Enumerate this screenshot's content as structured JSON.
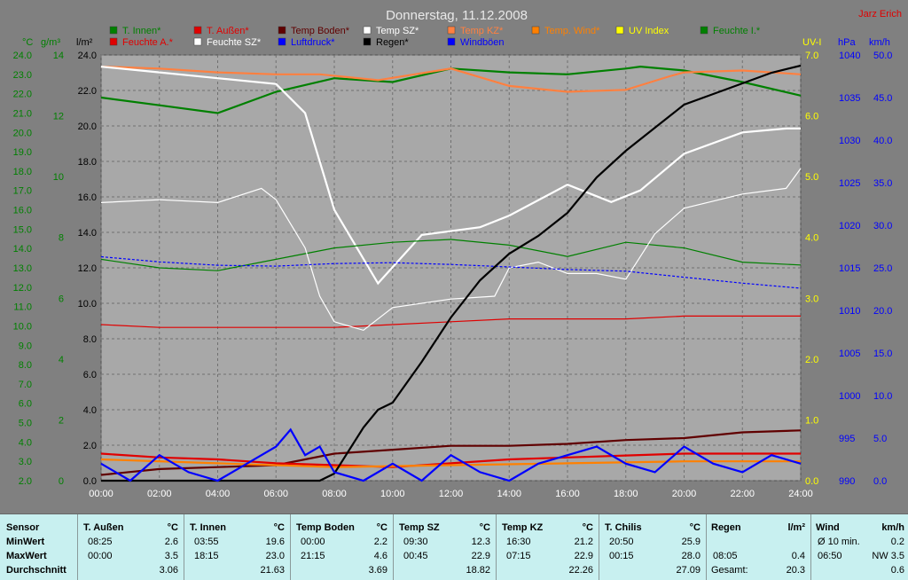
{
  "header": {
    "title": "Donnerstag, 11.12.2008",
    "author": "Jarz Erich"
  },
  "colors": {
    "bg": "#808080",
    "plot": "#a8a8a8",
    "t_innen": "#008000",
    "t_aussen": "#e00000",
    "temp_boden": "#600000",
    "temp_sz": "#ffffff",
    "temp_kz": "#ff8040",
    "temp_wind": "#ff8000",
    "uv_index": "#ffff00",
    "feuchte_i": "#008000",
    "feuchte_a": "#e00000",
    "feuchte_sz": "#ffffff",
    "luftdruck": "#0000ff",
    "regen": "#000000",
    "windboeen": "#0000ff",
    "footer": "#c8f0f0"
  },
  "legend": [
    {
      "label": "T. Innen*",
      "color": "#008000"
    },
    {
      "label": "T. Außen*",
      "color": "#e00000"
    },
    {
      "label": "Temp Boden*",
      "color": "#600000"
    },
    {
      "label": "Temp SZ*",
      "color": "#ffffff"
    },
    {
      "label": "Temp KZ*",
      "color": "#ff8040"
    },
    {
      "label": "Temp. Wind*",
      "color": "#ff8000"
    },
    {
      "label": "UV Index",
      "color": "#ffff00"
    },
    {
      "label": "Feuchte I.*",
      "color": "#008000"
    },
    {
      "label": "Feuchte A.*",
      "color": "#e00000"
    },
    {
      "label": "Feuchte SZ*",
      "color": "#ffffff"
    },
    {
      "label": "Luftdruck*",
      "color": "#0000ff"
    },
    {
      "label": "Regen*",
      "color": "#000000"
    },
    {
      "label": "Windböen",
      "color": "#0000ff"
    }
  ],
  "chart_data": {
    "type": "line",
    "title": "Donnerstag, 11.12.2008",
    "xlabel": "",
    "x_ticks": [
      "00:00",
      "02:00",
      "04:00",
      "06:00",
      "08:00",
      "10:00",
      "12:00",
      "14:00",
      "16:00",
      "18:00",
      "20:00",
      "22:00",
      "24:00"
    ],
    "grid": true,
    "axes": {
      "temp": {
        "unit": "°C",
        "color": "#008000",
        "range": [
          2,
          24
        ],
        "ticks": [
          "24.0",
          "23.0",
          "22.0",
          "21.0",
          "20.0",
          "19.0",
          "18.0",
          "17.0",
          "16.0",
          "15.0",
          "14.0",
          "13.0",
          "12.0",
          "11.0",
          "10.0",
          "9.0",
          "8.0",
          "7.0",
          "6.0",
          "5.0",
          "4.0",
          "3.0",
          "2.0"
        ]
      },
      "humidity": {
        "unit": "g/m³",
        "color": "#008000",
        "range": [
          0,
          15
        ],
        "ticks": [
          "14",
          "12",
          "10",
          "8",
          "6",
          "4",
          "2",
          "0"
        ]
      },
      "rain": {
        "unit": "l/m²",
        "color": "#000000",
        "range": [
          0,
          24
        ],
        "ticks": [
          "24.0",
          "22.0",
          "20.0",
          "18.0",
          "16.0",
          "14.0",
          "12.0",
          "10.0",
          "8.0",
          "6.0",
          "4.0",
          "2.0",
          "0.0"
        ]
      },
      "uv": {
        "unit": "UV-I",
        "color": "#ffff00",
        "range": [
          0,
          7
        ],
        "ticks": [
          "7.0",
          "6.0",
          "5.0",
          "4.0",
          "3.0",
          "2.0",
          "1.0",
          "0.0"
        ]
      },
      "pressure": {
        "unit": "hPa",
        "color": "#0000ff",
        "range": [
          990,
          1040
        ],
        "ticks": [
          "1040",
          "1035",
          "1030",
          "1025",
          "1020",
          "1015",
          "1010",
          "1005",
          "1000",
          "995",
          "990"
        ]
      },
      "wind": {
        "unit": "km/h",
        "color": "#0000ff",
        "range": [
          0,
          50
        ],
        "ticks": [
          "50.0",
          "45.0",
          "40.0",
          "35.0",
          "30.0",
          "25.0",
          "20.0",
          "15.0",
          "10.0",
          "5.0",
          "0.0"
        ]
      }
    },
    "series": [
      {
        "name": "T. Innen*",
        "axis": "temp",
        "color": "#008000",
        "x": [
          0,
          2,
          4,
          6,
          8,
          10,
          12,
          14,
          16,
          18,
          18.5,
          20,
          22,
          24
        ],
        "y": [
          21.8,
          21.4,
          21.0,
          22.1,
          22.8,
          22.6,
          23.3,
          23.1,
          23.0,
          23.3,
          23.4,
          23.2,
          22.6,
          21.9
        ]
      },
      {
        "name": "Temp KZ*",
        "axis": "temp",
        "color": "#ff8040",
        "x": [
          0,
          2,
          4,
          6,
          7.5,
          9.5,
          12,
          14,
          16,
          18,
          19.5,
          20,
          22,
          24
        ],
        "y": [
          23.4,
          23.3,
          23.1,
          23.0,
          23.0,
          22.7,
          23.3,
          22.4,
          22.1,
          22.2,
          22.9,
          23.1,
          23.2,
          23.0
        ]
      },
      {
        "name": "Temp SZ*",
        "axis": "temp",
        "color": "#ffffff",
        "x": [
          0,
          2,
          4,
          6,
          7,
          8,
          9.5,
          11,
          13,
          14,
          16,
          17.5,
          18.5,
          20,
          22,
          23.5,
          24
        ],
        "y": [
          23.4,
          23.1,
          22.8,
          22.5,
          21.0,
          16.0,
          12.2,
          14.7,
          15.1,
          15.7,
          17.3,
          16.4,
          17.0,
          18.9,
          20.0,
          20.2,
          20.2
        ]
      },
      {
        "name": "Temp Boden*",
        "axis": "temp",
        "color": "#600000",
        "x": [
          0,
          2,
          4,
          6,
          8,
          10,
          12,
          14,
          16,
          18,
          20,
          22,
          24
        ],
        "y": [
          2.3,
          2.6,
          2.7,
          2.8,
          3.4,
          3.6,
          3.8,
          3.8,
          3.9,
          4.1,
          4.2,
          4.5,
          4.6
        ]
      },
      {
        "name": "T. Außen*",
        "axis": "temp",
        "color": "#e00000",
        "x": [
          0,
          2,
          4,
          6,
          8,
          10,
          12,
          14,
          16,
          18,
          20,
          22,
          24
        ],
        "y": [
          3.4,
          3.2,
          3.1,
          2.9,
          2.8,
          2.7,
          2.9,
          3.1,
          3.2,
          3.3,
          3.4,
          3.4,
          3.4
        ]
      },
      {
        "name": "Temp. Wind*",
        "axis": "temp",
        "color": "#ff8000",
        "x": [
          0,
          4,
          8,
          12,
          16,
          20,
          24
        ],
        "y": [
          3.1,
          2.9,
          2.7,
          2.8,
          2.9,
          3.0,
          3.0
        ]
      },
      {
        "name": "Feuchte I.*",
        "axis": "humidity",
        "color": "#008000",
        "x": [
          0,
          2,
          4,
          6,
          8,
          10,
          12,
          14,
          16,
          18,
          20,
          22,
          24
        ],
        "y": [
          7.8,
          7.5,
          7.4,
          7.8,
          8.2,
          8.4,
          8.5,
          8.3,
          7.9,
          8.4,
          8.2,
          7.7,
          7.6
        ]
      },
      {
        "name": "Feuchte A.*",
        "axis": "humidity",
        "color": "#e00000",
        "x": [
          0,
          2,
          4,
          6,
          8,
          10,
          12,
          14,
          16,
          18,
          20,
          22,
          24
        ],
        "y": [
          5.5,
          5.4,
          5.4,
          5.4,
          5.4,
          5.5,
          5.6,
          5.7,
          5.7,
          5.7,
          5.8,
          5.8,
          5.8
        ]
      },
      {
        "name": "Feuchte SZ*",
        "axis": "humidity",
        "color": "#ffffff",
        "x": [
          0,
          2,
          4,
          5.5,
          6,
          7,
          7.5,
          8,
          9,
          10,
          12,
          13.5,
          14,
          15,
          16,
          17,
          18,
          19,
          20,
          22,
          23.5,
          24
        ],
        "y": [
          9.8,
          9.9,
          9.8,
          10.3,
          9.9,
          8.2,
          6.5,
          5.6,
          5.3,
          6.1,
          6.4,
          6.5,
          7.5,
          7.7,
          7.3,
          7.3,
          7.1,
          8.7,
          9.6,
          10.1,
          10.3,
          11.0
        ]
      },
      {
        "name": "Luftdruck*",
        "axis": "pressure",
        "color": "#0000ff",
        "x": [
          0,
          2,
          4,
          6,
          8,
          10,
          12,
          14,
          16,
          18,
          20,
          22,
          24
        ],
        "y": [
          1016.3,
          1015.7,
          1015.3,
          1015.2,
          1015.5,
          1015.6,
          1015.4,
          1015.1,
          1014.8,
          1014.6,
          1013.9,
          1013.2,
          1012.6
        ]
      },
      {
        "name": "Regen*",
        "axis": "rain",
        "color": "#000000",
        "x": [
          0,
          7.5,
          8,
          9,
          9.5,
          10,
          11,
          12,
          13,
          14,
          15,
          16,
          17,
          18,
          19,
          20,
          21,
          22,
          23,
          24
        ],
        "y": [
          0,
          0,
          0.4,
          3.0,
          4.0,
          4.4,
          6.7,
          9.2,
          11.3,
          12.8,
          13.8,
          15.1,
          17.1,
          18.6,
          19.9,
          21.2,
          21.8,
          22.4,
          23.0,
          23.4
        ]
      },
      {
        "name": "Windböen",
        "axis": "wind",
        "color": "#0000ff",
        "x": [
          0,
          1,
          2,
          3,
          4,
          5,
          6,
          6.5,
          7,
          7.5,
          8,
          9,
          10,
          11,
          12,
          13,
          14,
          15,
          16,
          17,
          18,
          19,
          20,
          21,
          22,
          23,
          24
        ],
        "y": [
          2,
          0,
          3,
          1,
          0,
          2,
          4,
          6,
          3,
          4,
          1,
          0,
          2,
          0,
          3,
          1,
          0,
          2,
          3,
          4,
          2,
          1,
          4,
          2,
          1,
          3,
          2
        ]
      }
    ]
  },
  "footer": {
    "row_labels": {
      "sensor": "Sensor",
      "min": "MinWert",
      "max": "MaxWert",
      "avg": "Durchschnitt"
    },
    "columns": [
      {
        "name": "T. Außen",
        "unit": "°C",
        "min_time": "08:25",
        "min_val": "2.6",
        "max_time": "00:00",
        "max_val": "3.5",
        "avg": "3.06"
      },
      {
        "name": "T. Innen",
        "unit": "°C",
        "min_time": "03:55",
        "min_val": "19.6",
        "max_time": "18:15",
        "max_val": "23.0",
        "avg": "21.63"
      },
      {
        "name": "Temp Boden",
        "unit": "°C",
        "min_time": "00:00",
        "min_val": "2.2",
        "max_time": "21:15",
        "max_val": "4.6",
        "avg": "3.69"
      },
      {
        "name": "Temp SZ",
        "unit": "°C",
        "min_time": "09:30",
        "min_val": "12.3",
        "max_time": "00:45",
        "max_val": "22.9",
        "avg": "18.82"
      },
      {
        "name": "Temp KZ",
        "unit": "°C",
        "min_time": "16:30",
        "min_val": "21.2",
        "max_time": "07:15",
        "max_val": "22.9",
        "avg": "22.26"
      },
      {
        "name": "T. Chilis",
        "unit": "°C",
        "min_time": "20:50",
        "min_val": "25.9",
        "max_time": "00:15",
        "max_val": "28.0",
        "avg": "27.09"
      }
    ],
    "regen": {
      "name": "Regen",
      "unit": "l/m²",
      "max_time": "08:05",
      "max_val": "0.4",
      "total_label": "Gesamt:",
      "total": "20.3"
    },
    "wind": {
      "name": "Wind",
      "unit": "km/h",
      "min_label": "Ø 10 min.",
      "min_val": "0.2",
      "max_time": "06:50",
      "max_val": "NW 3.5",
      "avg": "0.6"
    }
  }
}
